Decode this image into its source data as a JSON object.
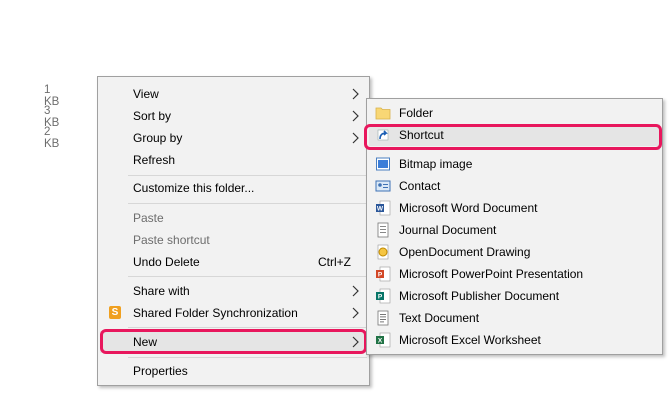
{
  "file_sizes": [
    "1 KB",
    "3 KB",
    "2 KB"
  ],
  "context_menu": {
    "view": "View",
    "sort_by": "Sort by",
    "group_by": "Group by",
    "refresh": "Refresh",
    "customize": "Customize this folder...",
    "paste": "Paste",
    "paste_shortcut": "Paste shortcut",
    "undo_delete": "Undo Delete",
    "undo_shortcut": "Ctrl+Z",
    "share_with": "Share with",
    "shared_folder_sync": "Shared Folder Synchronization",
    "shared_folder_sync_icon": "S",
    "new": "New",
    "properties": "Properties"
  },
  "new_submenu": {
    "folder": "Folder",
    "shortcut": "Shortcut",
    "bitmap": "Bitmap image",
    "contact": "Contact",
    "word": "Microsoft Word Document",
    "journal": "Journal Document",
    "od_drawing": "OpenDocument Drawing",
    "powerpoint": "Microsoft PowerPoint Presentation",
    "publisher": "Microsoft Publisher Document",
    "text": "Text Document",
    "excel": "Microsoft Excel Worksheet"
  },
  "colors": {
    "highlight_ring": "#e8175d",
    "menu_bg": "#f2f2f2",
    "hover_bg": "#e5e5e5"
  }
}
